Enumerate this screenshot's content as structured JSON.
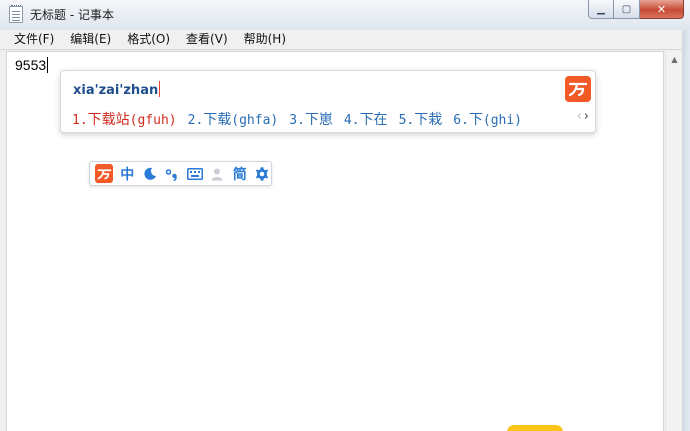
{
  "window": {
    "title": "无标题 - 记事本",
    "icon": "notepad-icon",
    "controls": {
      "minimize": "▁",
      "maximize": "▢",
      "close": "✕"
    }
  },
  "menu": [
    {
      "label": "文件(F)"
    },
    {
      "label": "编辑(E)"
    },
    {
      "label": "格式(O)"
    },
    {
      "label": "查看(V)"
    },
    {
      "label": "帮助(H)"
    }
  ],
  "editor": {
    "text": "9553"
  },
  "ime": {
    "pinyin": "xia'zai'zhan",
    "candidates": [
      {
        "num": "1.",
        "word": "下载站",
        "code": "(gfuh)"
      },
      {
        "num": "2.",
        "word": "下载",
        "code": "(ghfa)"
      },
      {
        "num": "3.",
        "word": "下崽",
        "code": ""
      },
      {
        "num": "4.",
        "word": "下在",
        "code": ""
      },
      {
        "num": "5.",
        "word": "下栽",
        "code": ""
      },
      {
        "num": "6.",
        "word": "下",
        "code": "(ghi)"
      }
    ],
    "page_prev": "‹",
    "page_next": "›",
    "status_bar": {
      "mode": "中",
      "script": "简"
    }
  },
  "colors": {
    "ime_brand": "#f15a24",
    "candidate_selected": "#d42a1e",
    "candidate": "#2a6db5",
    "status_icon": "#2a7ad8"
  }
}
